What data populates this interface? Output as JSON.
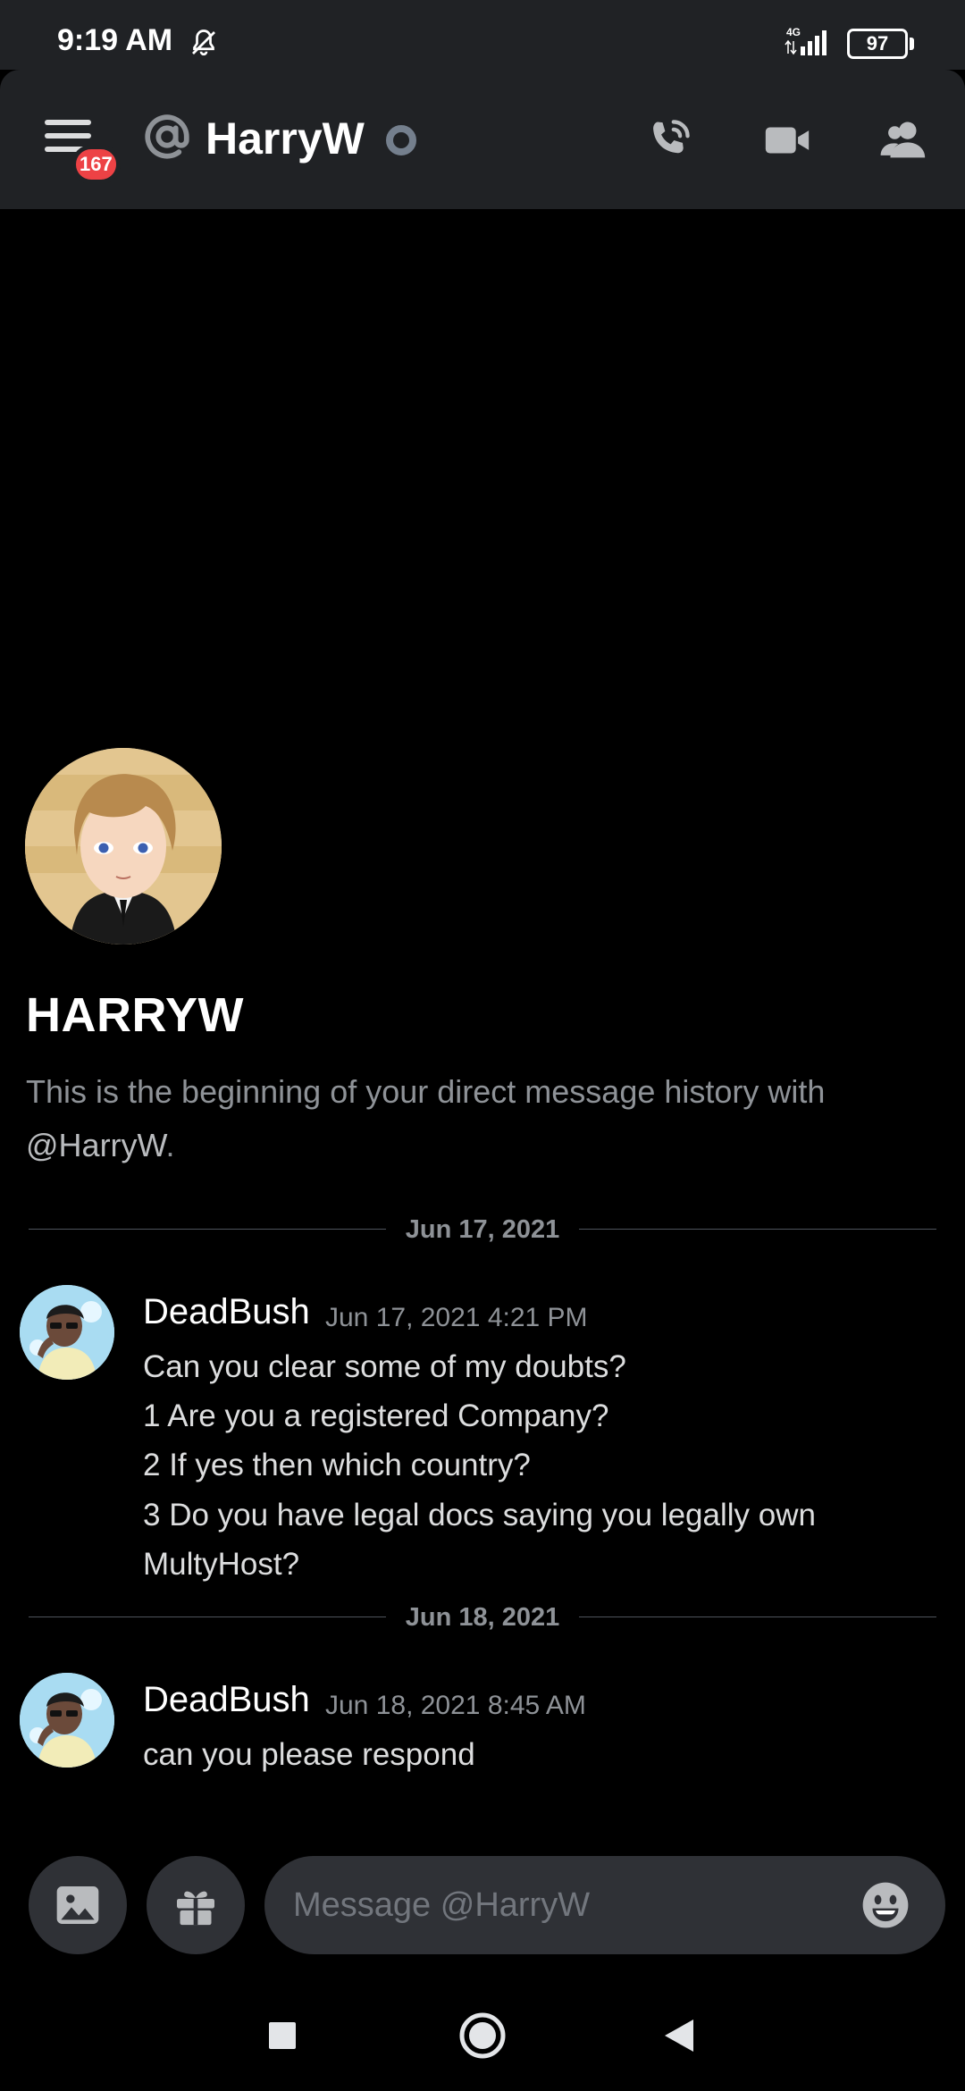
{
  "status_bar": {
    "time": "9:19 AM",
    "network": "4G",
    "battery": "97",
    "icons": [
      "bell-off-icon",
      "signal-icon",
      "battery-icon"
    ]
  },
  "header": {
    "unread_badge": "167",
    "title": "HarryW",
    "status": "offline",
    "icons": [
      "hamburger-menu-icon",
      "at-icon",
      "phone-call-icon",
      "video-call-icon",
      "members-icon"
    ]
  },
  "dm_intro": {
    "name": "HARRYW",
    "description_prefix": "This is the beginning of your direct message history with",
    "mention": "@HarryW",
    "description_suffix": "."
  },
  "messages": [
    {
      "date_divider": "Jun 17, 2021",
      "author": "DeadBush",
      "timestamp": "Jun 17, 2021 4:21 PM",
      "lines": [
        "Can you clear some of my doubts?",
        "1 Are you a registered Company?",
        "2 If yes then which country?",
        "3 Do you have legal docs saying you legally own",
        "MultyHost?"
      ]
    },
    {
      "date_divider": "Jun 18, 2021",
      "author": "DeadBush",
      "timestamp": "Jun 18, 2021 8:45 AM",
      "lines": [
        "can you please respond"
      ]
    }
  ],
  "composer": {
    "placeholder": "Message @HarryW",
    "icons": [
      "image-icon",
      "gift-icon",
      "emoji-icon"
    ]
  },
  "nav_bar": {
    "icons": [
      "recents-square-icon",
      "home-circle-icon",
      "back-triangle-icon"
    ]
  },
  "colors": {
    "background": "#000000",
    "header": "#202225",
    "input": "#2f3136",
    "badge": "#ed4245",
    "muted_text": "#8e9297"
  }
}
